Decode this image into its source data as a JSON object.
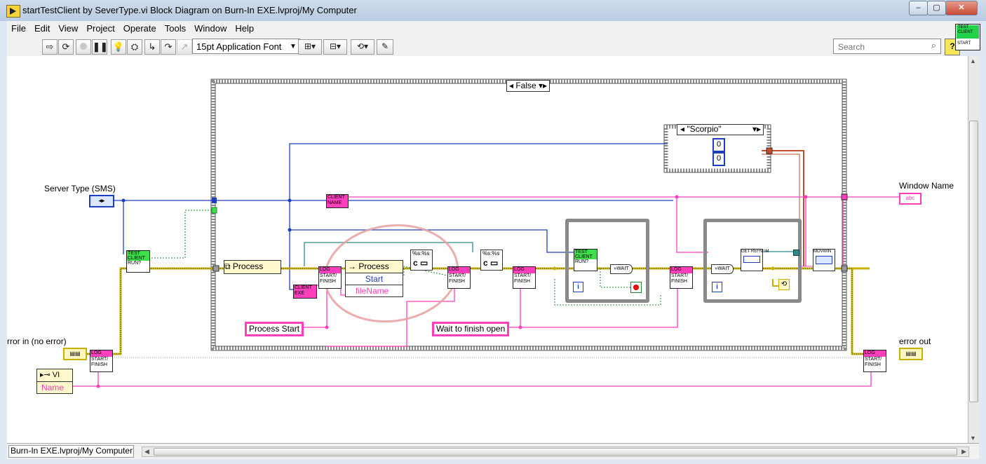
{
  "window": {
    "title": "startTestClient by SeverType.vi Block Diagram on Burn-In EXE.lvproj/My Computer",
    "buttons": [
      "–",
      "▢",
      "✕"
    ]
  },
  "menu": [
    "File",
    "Edit",
    "View",
    "Project",
    "Operate",
    "Tools",
    "Window",
    "Help"
  ],
  "toolbar": {
    "font": "15pt Application Font",
    "search_placeholder": "Search",
    "help": "?"
  },
  "vi_icon": {
    "line1": "TEST",
    "line2": "CLIENT",
    "line3": "START"
  },
  "diagram": {
    "case_selector": "False",
    "enum_selector": "\"Scorpio\"",
    "numeric_a": "0",
    "numeric_b": "0",
    "server_type_label": "Server Type (SMS)",
    "window_name_label": "Window Name",
    "error_in_label": "rror in (no error)",
    "error_out_label": "error out",
    "vi_ref": "VI",
    "vi_name": "Name",
    "process_1": "Process",
    "process_2": "Process",
    "process_start_method": "Start",
    "filename_prop": "fileName",
    "string_process_start": "Process Start",
    "string_wait": "Wait to finish open",
    "client_name": "CLIENT NAME",
    "client_exe": "CLIENT EXE",
    "test_client_run": "TEST CLIENT RUN?",
    "log": "LOG",
    "start_finish": "START/ FINISH",
    "wait": "WAIT",
    "get_refnum": "GET REFNUM",
    "movwin": "MOVWIN",
    "loop_index": "i",
    "format_c": "c",
    "format_code": "%s:%s"
  },
  "status": {
    "path": "Burn-In EXE.lvproj/My Computer"
  },
  "colors": {
    "string_wire": "#ff3fbb",
    "numeric_wire": "#1d3fbf",
    "error_wire": "#c8b000",
    "bool_wire": "#1e8a2e"
  }
}
